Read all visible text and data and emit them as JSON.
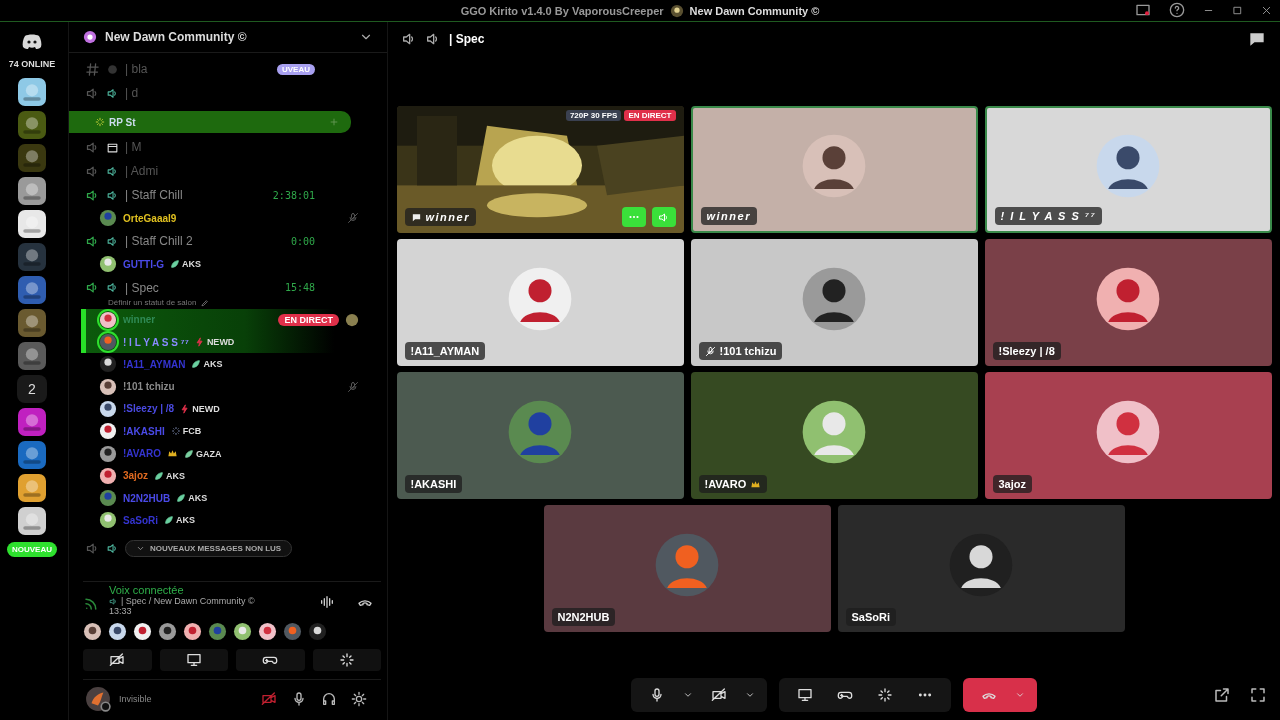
{
  "titlebar": {
    "title": "GGO Kirito v1.4.0 By VaporousCreeper",
    "server": "New Dawn Community ©"
  },
  "rail": {
    "online": "74 ONLINE",
    "new_badge": "NOUVEAU",
    "servers": [
      {
        "kind": "picture",
        "color": "#8ec9e6"
      },
      {
        "kind": "picture",
        "color": "#4a5a12"
      },
      {
        "kind": "picture",
        "color": "#3a3810"
      },
      {
        "kind": "picture",
        "color": "#9a9a9a"
      },
      {
        "kind": "picture",
        "color": "#e8e8e8"
      },
      {
        "kind": "picture",
        "color": "#26323e"
      },
      {
        "kind": "picture",
        "color": "#2f5db0"
      },
      {
        "kind": "picture",
        "color": "#6a5a30"
      },
      {
        "kind": "picture",
        "color": "#5a5a5a"
      },
      {
        "kind": "count",
        "label": "2"
      },
      {
        "kind": "picture",
        "color": "#c020c0"
      },
      {
        "kind": "picture",
        "color": "#1a6ac0"
      },
      {
        "kind": "picture",
        "color": "#e0a030"
      },
      {
        "kind": "picture",
        "color": "#d0d0d0"
      }
    ]
  },
  "sidebar": {
    "server_name": "New Dawn Community ©",
    "channels": [
      {
        "kind": "text",
        "name": "| bla",
        "badge": "UVEAU"
      },
      {
        "kind": "voice",
        "name": "| d"
      },
      {
        "kind": "category",
        "name": "RP St"
      },
      {
        "kind": "event",
        "name": "| M"
      },
      {
        "kind": "voice",
        "name": "| Admi"
      },
      {
        "kind": "voice",
        "name": "| Staff Chill",
        "time": "2:38:01",
        "members": [
          {
            "name": "OrteGaaal9",
            "color": "#e0c020",
            "speaking": false,
            "muted": true,
            "crown": false
          }
        ]
      },
      {
        "kind": "voice",
        "name": "| Staff Chill 2",
        "time": "0:00",
        "members": [
          {
            "name": "GUTTI-G",
            "color": "#4a4ae8",
            "tag": "AKS",
            "speaking": false,
            "muted": false,
            "crown": false
          }
        ]
      },
      {
        "kind": "voice",
        "name": "| Spec",
        "time": "15:48",
        "status": "Définir un statut de salon",
        "members": [
          {
            "name": "winner",
            "color": "#2f8a55",
            "live": "EN DIRECT",
            "speaking": true,
            "muted": false,
            "crown": false
          },
          {
            "name": "! I L Y A S S ⁷⁷",
            "color": "#8a8aff",
            "tag": "NEWD",
            "speaking": true,
            "muted": false,
            "crown": false
          },
          {
            "name": "!A11_AYMAN",
            "color": "#3434d0",
            "tag": "AKS",
            "speaking": false,
            "muted": false,
            "crown": false
          },
          {
            "name": "!101 tchizu",
            "color": "#8a8a8a",
            "speaking": false,
            "muted": true,
            "crown": false
          },
          {
            "name": "!Sleezy | /8",
            "color": "#4a4ae0",
            "tag": "NEWD",
            "speaking": false,
            "muted": false,
            "crown": false
          },
          {
            "name": "!AKASHI",
            "color": "#4a4ae8",
            "tag": "FCB",
            "speaking": false,
            "muted": false,
            "crown": false
          },
          {
            "name": "!AVARO",
            "color": "#3434d0",
            "tag": "GAZA",
            "speaking": false,
            "muted": false,
            "crown": true
          },
          {
            "name": "3ajoz",
            "color": "#e06a20",
            "tag": "AKS",
            "speaking": false,
            "muted": false,
            "crown": false
          },
          {
            "name": "N2N2HUB",
            "color": "#4a4ae8",
            "tag": "AKS",
            "speaking": false,
            "muted": false,
            "crown": false
          },
          {
            "name": "SaSoRi",
            "color": "#3434d0",
            "tag": "AKS",
            "speaking": false,
            "muted": false,
            "crown": false
          }
        ]
      }
    ],
    "unread": "NOUVEAUX MESSAGES NON LUS"
  },
  "voice_panel": {
    "status": "Voix connectée",
    "channel": "| Spec / New Dawn Community ©",
    "time": "13:33"
  },
  "user": {
    "status": "Invisible"
  },
  "main": {
    "channel": "| Spec",
    "tiles": [
      {
        "kind": "stream",
        "name": "winner",
        "quality": "720P 30 FPS",
        "live": "EN DIRECT",
        "speaking": false
      },
      {
        "kind": "user",
        "name": "winner",
        "color": "#c4b0a8",
        "speaking": true,
        "muted": false,
        "crown": false
      },
      {
        "kind": "user",
        "name": "! I L Y A S S ⁷⁷",
        "color": "#d8d8d8",
        "speaking": true,
        "muted": false,
        "crown": false
      },
      {
        "kind": "user",
        "name": "!A11_AYMAN",
        "color": "#d4d4d4",
        "speaking": false,
        "muted": false,
        "crown": false
      },
      {
        "kind": "user",
        "name": "!101 tchizu",
        "color": "#c8c8c8",
        "speaking": false,
        "muted": true,
        "crown": false
      },
      {
        "kind": "user",
        "name": "!Sleezy | /8",
        "color": "#7a4048",
        "speaking": false,
        "muted": false,
        "crown": false
      },
      {
        "kind": "user",
        "name": "!AKASHI",
        "color": "#4c5a50",
        "speaking": false,
        "muted": false,
        "crown": false
      },
      {
        "kind": "user",
        "name": "!AVARO",
        "color": "#364a22",
        "speaking": false,
        "muted": false,
        "crown": true
      },
      {
        "kind": "user",
        "name": "3ajoz",
        "color": "#a84050",
        "speaking": false,
        "muted": false,
        "crown": false
      },
      {
        "kind": "user",
        "name": "N2N2HUB",
        "color": "#5a3a40",
        "speaking": false,
        "muted": false,
        "crown": false
      },
      {
        "kind": "user",
        "name": "SaSoRi",
        "color": "#2a2a2a",
        "speaking": false,
        "muted": false,
        "crown": false
      }
    ]
  }
}
